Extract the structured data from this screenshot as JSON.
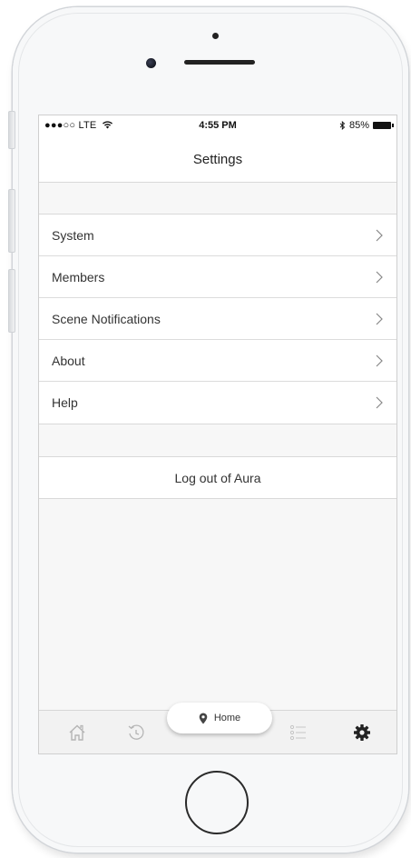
{
  "status_bar": {
    "carrier": "●●●○○ LTE",
    "time": "4:55 PM",
    "battery": "85%"
  },
  "nav": {
    "title": "Settings"
  },
  "menu": {
    "items": [
      {
        "label": "System"
      },
      {
        "label": "Members"
      },
      {
        "label": "Scene Notifications"
      },
      {
        "label": "About"
      },
      {
        "label": "Help"
      }
    ]
  },
  "logout": {
    "label": "Log out of Aura"
  },
  "tab_bar": {
    "home_label": "Home",
    "icons": [
      "house-icon",
      "history-icon",
      "list-icon",
      "gear-icon"
    ]
  },
  "colors": {
    "background": "#f7f7f7",
    "text": "#333333",
    "separator": "#d9d9d9",
    "active_tab": "#222222",
    "inactive_tab": "#b5b5b5"
  }
}
